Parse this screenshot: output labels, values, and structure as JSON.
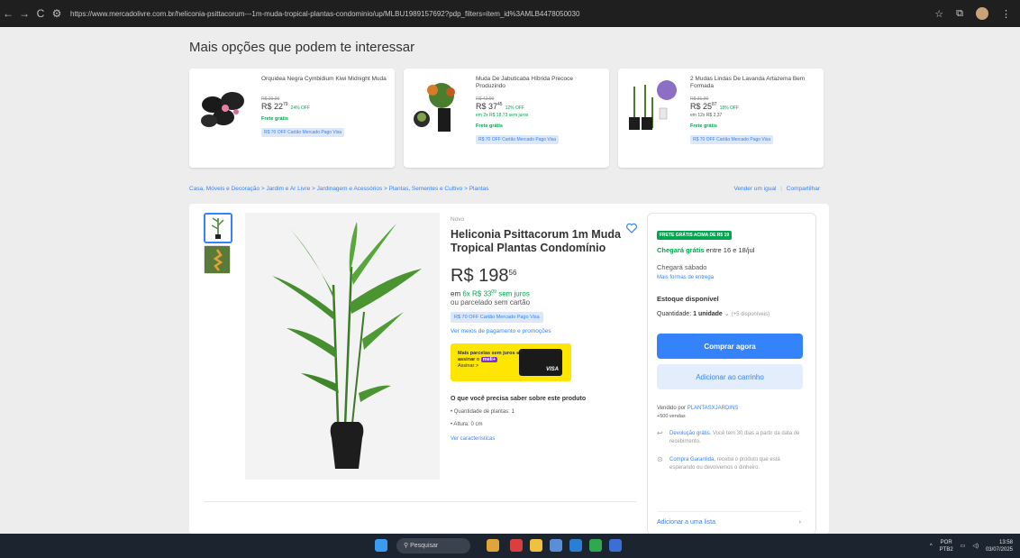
{
  "browser": {
    "url": "https://www.mercadolivre.com.br/heliconia-psittacorum---1m-muda-tropical-plantas-condominio/up/MLBU1989157692?pdp_filters=item_id%3AMLB4478050030",
    "nav": {
      "back": "←",
      "forward": "→",
      "reload": "C",
      "site_info": "⚙"
    },
    "right_icons": {
      "star": "☆",
      "extensions": "⧉",
      "menu": "⋮"
    }
  },
  "section_title": "Mais opções que podem te interessar",
  "recommendations": [
    {
      "title": "Orquidea Negra Cymbidium Kiwi Midnight Muda",
      "old_price": "R$ 29,99",
      "price": "R$ 22",
      "price_cents": "79",
      "discount": "24% OFF",
      "installment": "",
      "installment_plain": "",
      "shipping": "Frete grátis",
      "promo": "R$ 70 OFF Cartão Mercado Pago Visa"
    },
    {
      "title": "Muda De Jabuticaba Híbrida Precoce Produzindo",
      "old_price": "R$ 42,90",
      "price": "R$ 37",
      "price_cents": "45",
      "discount": "12% OFF",
      "installment": "em 2x R$ 18,73 sem juros",
      "installment_plain": "",
      "shipping": "Frete grátis",
      "promo": "R$ 70 OFF Cartão Mercado Pago Visa"
    },
    {
      "title": "2 Mudas Lindas De Lavanda Artazema Bem Formada",
      "old_price": "R$ 31,90",
      "price": "R$ 25",
      "price_cents": "87",
      "discount": "18% OFF",
      "installment": "",
      "installment_plain": "em 12x R$ 2,37",
      "shipping": "Frete grátis",
      "promo": "R$ 70 OFF Cartão Mercado Pago Visa"
    }
  ],
  "breadcrumb": "Casa, Móveis e Decoração > Jardim e Ar Livre > Jardinagem e Acessórios > Plantas, Sementes e Cultivo > Plantas",
  "breadcrumb_right": {
    "sell": "Vender um igual",
    "sep": "|",
    "share": "Compartilhar"
  },
  "product": {
    "condition": "Novo",
    "title": "Heliconia Psittacorum 1m Muda Tropical Plantas Condomínio",
    "price": "R$ 198",
    "price_cents": "56",
    "installment_pre": "em",
    "installment": "6x R$ 33",
    "installment_cents": "09",
    "installment_post": "sem juros",
    "installment_alt": "ou parcelado sem cartão",
    "promo": "R$ 70 OFF Cartão Mercado Pago Visa",
    "pay_link": "Ver meios de pagamento e promoções",
    "banner_text": "Mais parcelas sem juros ao assinar o",
    "banner_badge": "meli+",
    "banner_link": "Assinar >",
    "banner_card": "VISA",
    "know_title": "O que você precisa saber sobre este produto",
    "bullets": [
      "• Quantidade de plantas: 1",
      "• Altura: 0 cm"
    ],
    "chars_link": "Ver características"
  },
  "buybox": {
    "free_badge": "FRETE GRÁTIS ACIMA DE R$ 19",
    "arrival_green": "Chegará grátis",
    "arrival_rest": "entre 16 e 18/jul",
    "arrival2": "Chegará sábado",
    "more_forms": "Mais formas de entrega",
    "stock": "Estoque disponível",
    "qty_label": "Quantidade:",
    "qty_value": "1 unidade",
    "qty_avail": "(+5 disponíveis)",
    "buy": "Comprar agora",
    "cart": "Adicionar ao carrinho",
    "seller_label": "Vendido por",
    "seller_name": "PLANTASXJARDINS",
    "sales": "+500 vendas",
    "returns_link": "Devolução grátis.",
    "returns_text": "Você tem 30 dias a partir da data de recebimento.",
    "guarantee_link": "Compra Garantida,",
    "guarantee_text": "receba o produto que está esperando ou devolvemos o dinheiro.",
    "add_list": "Adicionar a uma lista"
  },
  "taskbar": {
    "search": "Pesquisar",
    "lang1": "POR",
    "lang2": "PTB2",
    "time": "13:58",
    "date": "03/07/2025"
  },
  "colors": {
    "accent": "#3483fa",
    "green": "#00a650",
    "yellow": "#ffe600"
  }
}
